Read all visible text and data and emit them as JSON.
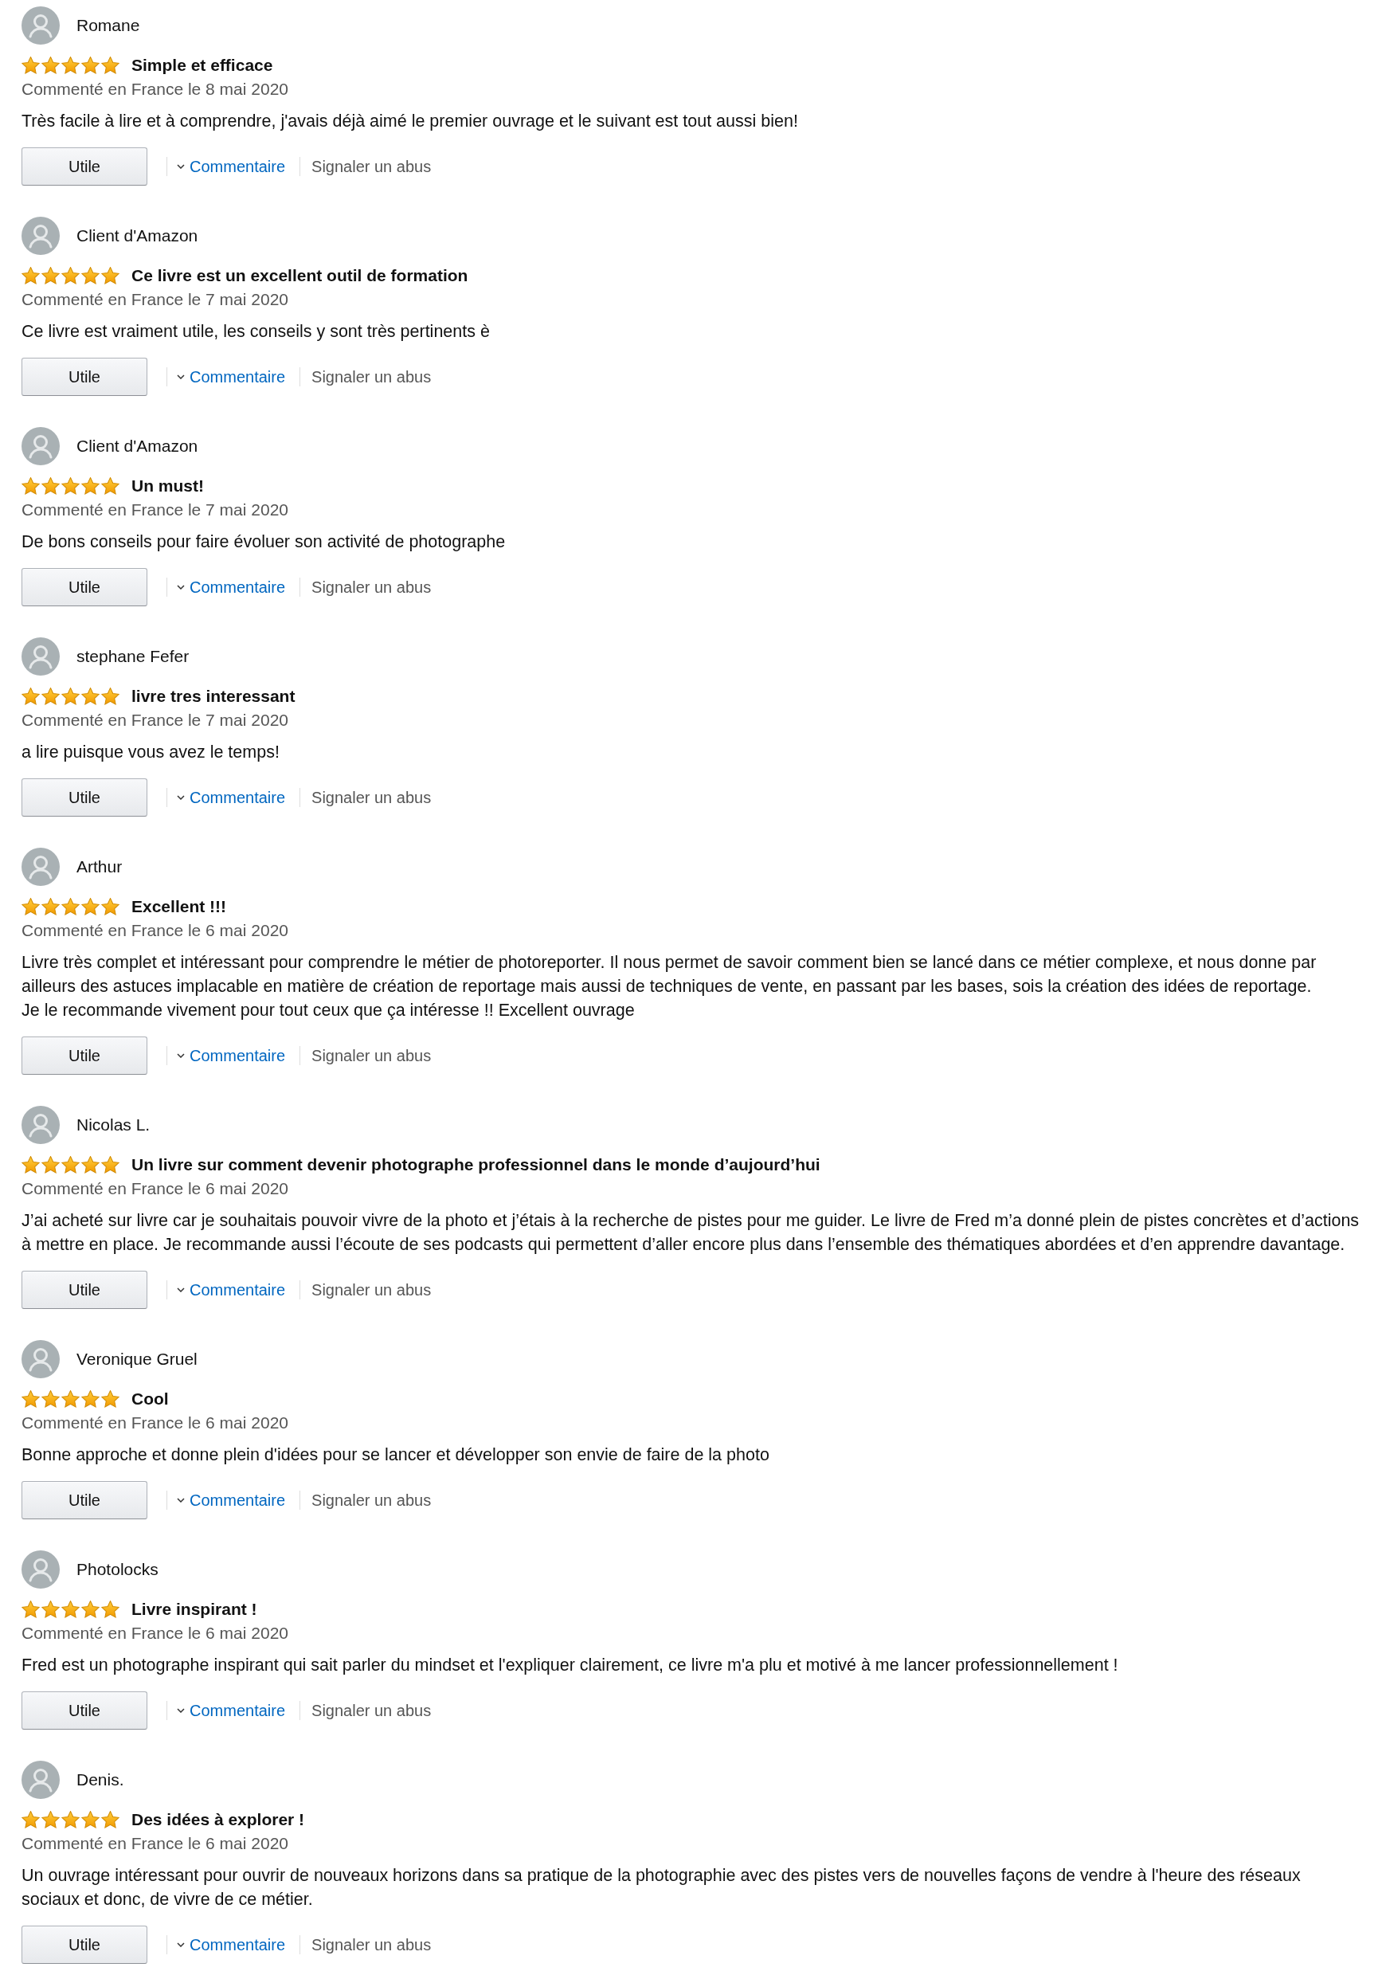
{
  "reviews": [
    {
      "author": "Romane",
      "stars": 5,
      "title": "Simple et efficace",
      "date": "Commenté en France le 8 mai 2020",
      "body": "Très facile à lire et à comprendre, j'avais déjà aimé le premier ouvrage et le suivant est tout aussi bien!",
      "helpful": "Utile",
      "comment": "Commentaire",
      "report": "Signaler un abus"
    },
    {
      "author": "Client d'Amazon",
      "stars": 5,
      "title": "Ce livre est un excellent outil de formation",
      "date": "Commenté en France le 7 mai 2020",
      "body": "Ce livre est vraiment utile, les conseils y sont très pertinents è",
      "helpful": "Utile",
      "comment": "Commentaire",
      "report": "Signaler un abus"
    },
    {
      "author": "Client d'Amazon",
      "stars": 5,
      "title": "Un must!",
      "date": "Commenté en France le 7 mai 2020",
      "body": "De bons conseils pour faire évoluer son activité de photographe",
      "helpful": "Utile",
      "comment": "Commentaire",
      "report": "Signaler un abus"
    },
    {
      "author": "stephane Fefer",
      "stars": 5,
      "title": "livre tres interessant",
      "date": "Commenté en France le 7 mai 2020",
      "body": "a lire puisque vous avez le temps!",
      "helpful": "Utile",
      "comment": "Commentaire",
      "report": "Signaler un abus"
    },
    {
      "author": "Arthur",
      "stars": 5,
      "title": "Excellent !!!",
      "date": "Commenté en France le 6 mai 2020",
      "body": "Livre très complet et intéressant pour comprendre le métier de photoreporter. Il nous permet de savoir comment bien se lancé dans ce métier complexe, et nous donne par ailleurs des astuces implacable en matière de création de reportage mais aussi de techniques de vente, en passant par les bases, sois la création des idées de reportage.\nJe le recommande vivement pour tout ceux que ça intéresse !! Excellent ouvrage",
      "helpful": "Utile",
      "comment": "Commentaire",
      "report": "Signaler un abus"
    },
    {
      "author": "Nicolas L.",
      "stars": 5,
      "title": "Un livre sur comment devenir photographe professionnel dans le monde d’aujourd’hui",
      "date": "Commenté en France le 6 mai 2020",
      "body": "J’ai acheté sur livre car je souhaitais pouvoir vivre de la photo et j’étais à la recherche de pistes pour me guider. Le livre de Fred m’a donné plein de pistes concrètes et d’actions à mettre en place. Je recommande aussi l’écoute de ses podcasts qui permettent d’aller encore plus dans l’ensemble des thématiques abordées et d’en apprendre davantage.",
      "helpful": "Utile",
      "comment": "Commentaire",
      "report": "Signaler un abus"
    },
    {
      "author": "Veronique Gruel",
      "stars": 5,
      "title": "Cool",
      "date": "Commenté en France le 6 mai 2020",
      "body": "Bonne approche et donne plein d'idées pour se lancer et développer son envie de faire de la photo",
      "helpful": "Utile",
      "comment": "Commentaire",
      "report": "Signaler un abus"
    },
    {
      "author": "Photolocks",
      "stars": 5,
      "title": "Livre inspirant !",
      "date": "Commenté en France le 6 mai 2020",
      "body": "Fred est un photographe inspirant qui sait parler du mindset et l'expliquer clairement, ce livre m'a plu et motivé à me lancer professionnellement !",
      "helpful": "Utile",
      "comment": "Commentaire",
      "report": "Signaler un abus"
    },
    {
      "author": "Denis.",
      "stars": 5,
      "title": "Des idées à explorer !",
      "date": "Commenté en France le 6 mai 2020",
      "body": "Un ouvrage intéressant pour ouvrir de nouveaux horizons dans sa pratique de la photographie avec des pistes vers de nouvelles façons de vendre à l'heure des réseaux sociaux et donc, de vivre de ce métier.",
      "helpful": "Utile",
      "comment": "Commentaire",
      "report": "Signaler un abus"
    }
  ]
}
